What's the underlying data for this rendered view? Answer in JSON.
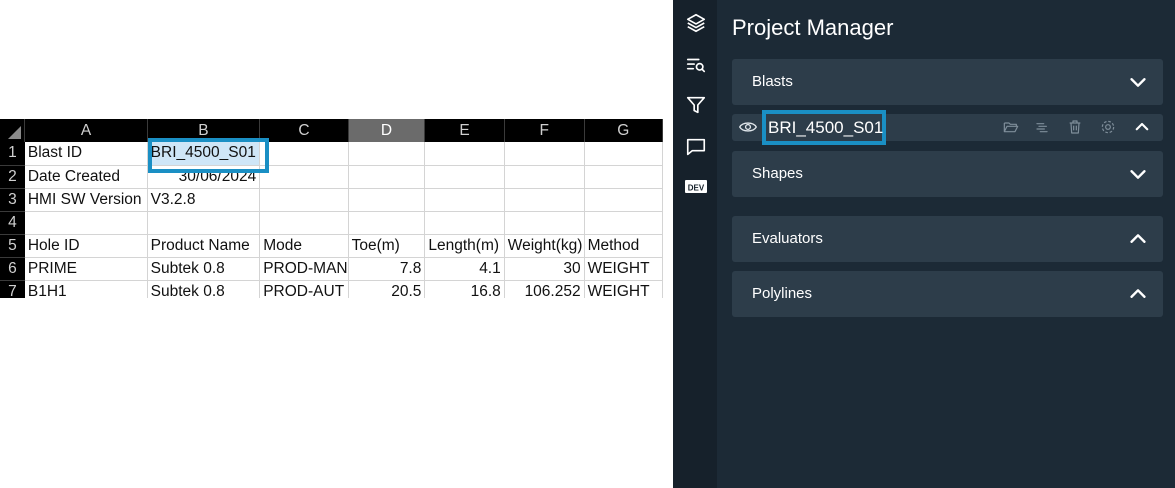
{
  "spreadsheet": {
    "columns": [
      "A",
      "B",
      "C",
      "D",
      "E",
      "F",
      "G"
    ],
    "active_column": "D",
    "rows": [
      {
        "num": "1",
        "cells": [
          "Blast ID",
          "BRI_4500_S01",
          "",
          "",
          "",
          "",
          ""
        ]
      },
      {
        "num": "2",
        "cells": [
          "Date Created",
          "30/06/2024",
          "",
          "",
          "",
          "",
          ""
        ]
      },
      {
        "num": "3",
        "cells": [
          "HMI SW Version",
          "V3.2.8",
          "",
          "",
          "",
          "",
          ""
        ]
      },
      {
        "num": "4",
        "cells": [
          "",
          "",
          "",
          "",
          "",
          "",
          ""
        ]
      },
      {
        "num": "5",
        "cells": [
          "Hole ID",
          "Product Name",
          "Mode",
          "Toe(m)",
          "Length(m)",
          "Weight(kg)",
          "Method"
        ]
      },
      {
        "num": "6",
        "cells": [
          "PRIME",
          "Subtek 0.8",
          "PROD-MAN",
          "7.8",
          "4.1",
          "30",
          "WEIGHT"
        ]
      },
      {
        "num": "7",
        "cells": [
          "B1H1",
          "Subtek 0.8",
          "PROD-AUT",
          "20.5",
          "16.8",
          "106.252",
          "WEIGHT"
        ]
      }
    ]
  },
  "app": {
    "title": "Project Manager",
    "sidebar_icons": [
      "layers-icon",
      "search-list-icon",
      "filter-icon",
      "comment-icon",
      "dev-icon"
    ],
    "dev_label": "DEV",
    "sections": {
      "blasts": "Blasts",
      "shapes": "Shapes",
      "evaluators": "Evaluators",
      "polylines": "Polylines"
    },
    "blast_item": {
      "name": "BRI_4500_S01",
      "icons": [
        "eye-icon",
        "folder-open-icon",
        "wind-icon",
        "trash-icon",
        "gear-icon",
        "chevron-up-icon"
      ]
    },
    "colors": {
      "panel_bg": "#1c2a36",
      "section_bg": "#2d3d4a",
      "highlight": "#1a8fc4"
    }
  }
}
